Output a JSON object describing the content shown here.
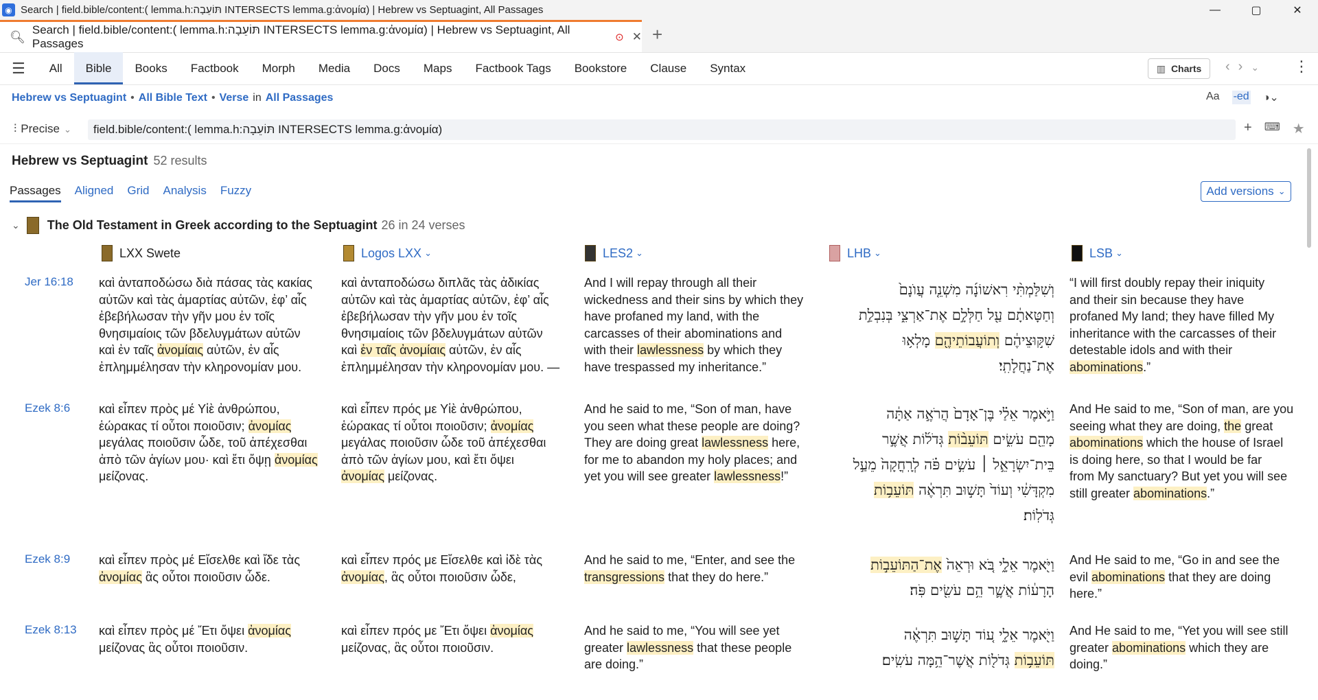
{
  "window": {
    "title": "Search | field.bible/content:( lemma.h:תּוֹעֵבָה INTERSECTS lemma.g:ἀνομία) | Hebrew vs Septuagint, All Passages",
    "controls": [
      "—",
      "▢",
      "✕"
    ]
  },
  "tab": {
    "label": "Search | field.bible/content:( lemma.h:תּוֹעֵבָה INTERSECTS lemma.g:ἀνομία) | Hebrew vs Septuagint, All Passages",
    "close": "✕",
    "new_tab": "+"
  },
  "nav": {
    "items": [
      "All",
      "Bible",
      "Books",
      "Factbook",
      "Morph",
      "Media",
      "Docs",
      "Maps",
      "Factbook Tags",
      "Bookstore",
      "Clause",
      "Syntax"
    ],
    "active": "Bible",
    "charts_label": "Charts"
  },
  "breadcrumb": {
    "scope": "Hebrew vs Septuagint",
    "text": "All Bible Text",
    "unit": "Verse",
    "in": "in",
    "range": "All Passages"
  },
  "query": {
    "mode": "Precise",
    "value": "field.bible/content:( lemma.h:תּוֹעֵבָה INTERSECTS lemma.g:ἀνομία)"
  },
  "results": {
    "title": "Hebrew vs Septuagint",
    "count": "52 results"
  },
  "subtabs": [
    "Passages",
    "Aligned",
    "Grid",
    "Analysis",
    "Fuzzy"
  ],
  "add_versions": "Add versions",
  "group": {
    "title": "The Old Testament in Greek according to the Septuagint",
    "count": "26 in 24 verses"
  },
  "columns": [
    "LXX Swete",
    "Logos LXX",
    "LES2",
    "LHB",
    "LSB"
  ],
  "rows": [
    {
      "ref": "Jer 16:18",
      "c1": [
        "καὶ ἀνταποδώσω διὰ πάσας τὰς κακίας",
        "αὐτῶν καὶ τὰς ἁμαρτίας αὐτῶν, ἐφ’ αἷς",
        "ἐβεβήλωσαν τὴν γῆν μου ἐν τοῖς",
        "θνησιμαίοις τῶν βδελυγμάτων αὐτῶν",
        "καὶ ἐν ταῖς |ἀνομίαις| αὐτῶν, ἐν αἷς",
        "ἐπλημμέλησαν τὴν κληρονομίαν μου."
      ],
      "c2": [
        "καὶ ἀνταποδώσω διπλᾶς τὰς ἀδικίας",
        "αὐτῶν καὶ τὰς ἁμαρτίας αὐτῶν, ἐφ’ αἷς",
        "ἐβεβήλωσαν τὴν γῆν μου ἐν τοῖς",
        "θνησιμαίοις τῶν βδελυγμάτων αὐτῶν",
        "καὶ |ἐν ταῖς ἀνομίαις| αὐτῶν, ἐν αἷς",
        "ἐπλημμέλησαν τὴν κληρονομίαν μου. —"
      ],
      "c3": [
        "And I will repay through all their",
        "wickedness and their sins by which they",
        "have profaned my land, with the",
        "carcasses of their abominations and",
        "with their |lawlessness| by which they",
        "have trespassed my inheritance.”"
      ],
      "c4": [
        "וְשִׁלַּמְתִּ֨י רִאשׁוֹנָ֜ה מִשְׁנֵ֤ה עֲוֺנָם֙",
        "וְחַטָּאתָ֔ם עַ֖ל חַלְּלָ֣ם אֶת־אַרְצִ֑י בְּנִבְלַ֣ת",
        "שִׁקּ֣וּצֵיהֶ֔ם |וְתוֹעֲבוֹתֵיהֶ֖ם| מָלְא֥וּ",
        "אֶת־נַחֲלָתִֽי׃"
      ],
      "c5": [
        "“I will first doubly repay their iniquity",
        "and their sin because they have",
        "profaned My land; they have filled My",
        "inheritance with the carcasses of their",
        "detestable idols and with their",
        "|abominations|.”"
      ]
    },
    {
      "ref": "Ezek 8:6",
      "c1": [
        "καὶ εἶπεν πρὸς μέ Υἱὲ ἀνθρώπου,",
        "ἑώρακας τί οὗτοι ποιοῦσιν; |ἀνομίας|",
        "μεγάλας ποιοῦσιν ὧδε, τοῦ ἀπέχεσθαι",
        "ἀπὸ τῶν ἁγίων μου· καὶ ἔτι ὄψῃ |ἀνομίας|",
        "μείζονας."
      ],
      "c2": [
        "καὶ εἶπεν πρός με Υἱὲ ἀνθρώπου,",
        "ἑώρακας τί οὗτοι ποιοῦσιν; |ἀνομίας|",
        "μεγάλας ποιοῦσιν ὧδε τοῦ ἀπέχεσθαι",
        "ἀπὸ τῶν ἁγίων μου, καὶ ἔτι ὄψει",
        "|ἀνομίας| μείζονας."
      ],
      "c3": [
        "And he said to me, “Son of man, have",
        "you seen what these people are doing?",
        "They are doing great |lawlessness| here,",
        "for me to abandon my holy places; and",
        "yet you will see greater |lawlessness|!”"
      ],
      "c4": [
        "וַיֹּ֣אמֶר אֵלַ֗י בֶּן־אָדָם֙ הֲרֹאֶ֣ה אַתָּ֔ה",
        "מָהֵ֖ם עֹשִׂ֑ים |תּוֹעֵב֨וֹת| גְּדֹל֜וֹת אֲשֶׁ֣ר",
        "בֵּית־יִשְׂרָאֵ֣ל ׀ עֹשִׂ֣ים פֹּ֗ה לְרָֽחֳקָה֙ מֵעַ֣ל",
        "מִקְדָּשִׁ֔י וְעוֹד֙ תָּשׁ֣וּב תִּרְאֶ֔ה |תּוֹעֵב֥וֹת|",
        "גְּדֹלֽוֹת׃"
      ],
      "c5": [
        "And He said to me, “Son of man, are you",
        "seeing what they are doing, |the| great",
        "|abominations| which the house of Israel",
        "is doing here, so that I would be far",
        "from My sanctuary? But yet you will see",
        "still greater |abominations|.”"
      ]
    },
    {
      "ref": "Ezek 8:9",
      "c1": [
        "καὶ εἶπεν πρὸς μέ Εἴσελθε καὶ ἴδε τὰς",
        "|ἀνομίας| ἃς οὗτοι ποιοῦσιν ὧδε."
      ],
      "c2": [
        "καὶ εἶπεν πρός με Εἴσελθε καὶ ἰδὲ τὰς",
        "|ἀνομίας|, ἃς οὗτοι ποιοῦσιν ὧδε,"
      ],
      "c3": [
        "And he said to me, “Enter, and see the",
        "|transgressions| that they do here.”"
      ],
      "c4": [
        "וַיֹּ֖אמֶר אֵלָ֑י בֹּ֚א וּרְאֵה֙ |אֶת־הַתּוֹעֵב֣וֹת|",
        "הָרָע֔וֹת אֲשֶׁ֛ר הֵ֥ם עֹשִׂ֖ים פֹּֽה׃"
      ],
      "c5": [
        "And He said to me, “Go in and see the",
        "evil |abominations| that they are doing",
        "here.”"
      ]
    },
    {
      "ref": "Ezek 8:13",
      "c1": [
        "καὶ εἶπεν πρὸς μέ Ἔτι ὄψει |ἀνομίας|",
        "μείζονας ἃς οὗτοι ποιοῦσιν."
      ],
      "c2": [
        "καὶ εἶπεν πρός με Ἔτι ὄψει |ἀνομίας|",
        "μείζονας, ἃς οὗτοι ποιοῦσιν."
      ],
      "c3": [
        "And he said to me, “You will see yet",
        "greater |lawlessness| that these people",
        "are doing.”"
      ],
      "c4": [
        "וַיֹּ֖אמֶר אֵלָ֑י ע֚וֹד תָּשׁ֣וּב תִּרְאֶ֔ה",
        "|תּוֹעֵב֥וֹת| גְּדֹל֖וֹת אֲשֶׁר־הֵ֥מָּה עֹשִֽׂים׃"
      ],
      "c5": [
        "And He said to me, “Yet you will see still",
        "greater |abominations| which they are",
        "doing.”"
      ]
    }
  ]
}
